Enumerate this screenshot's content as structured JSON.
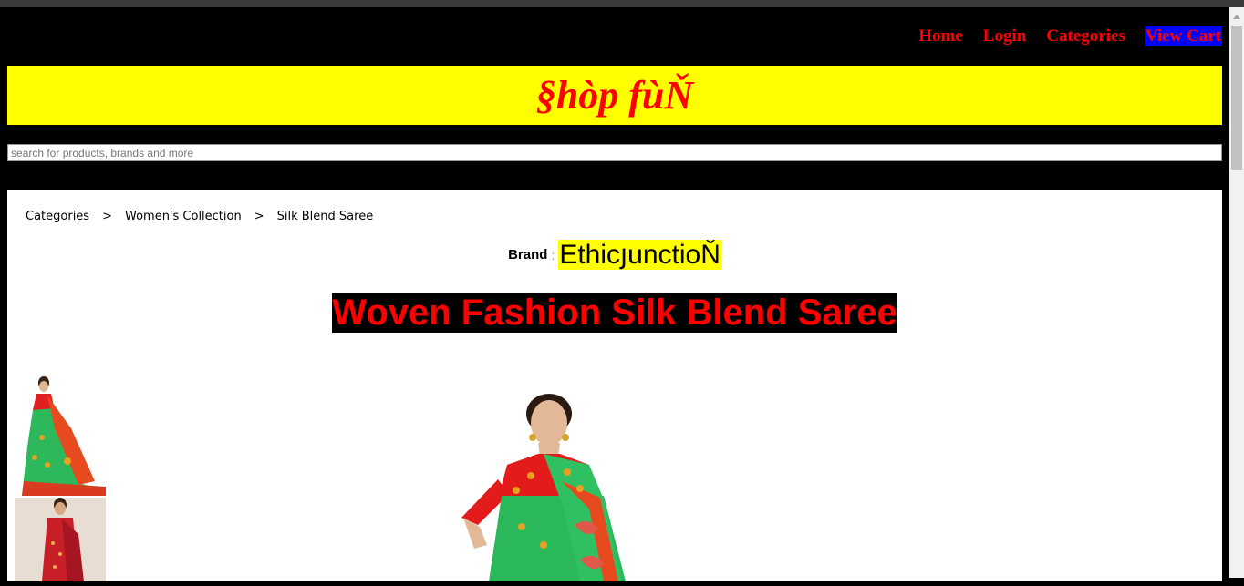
{
  "nav": {
    "items": [
      {
        "label": "Home"
      },
      {
        "label": "Login"
      },
      {
        "label": "Categories"
      },
      {
        "label": "View Cart"
      }
    ]
  },
  "banner": {
    "title": "§hòp fùŇ"
  },
  "search": {
    "placeholder": "search for products, brands and more"
  },
  "breadcrumb": {
    "items": [
      "Categories",
      "Women's Collection",
      "Silk Blend Saree"
    ],
    "separator": ">"
  },
  "product": {
    "brand_label": "Brand",
    "brand_colon": ":",
    "brand_name": "EthicյunctioŇ",
    "title": "Woven Fashion Silk Blend Saree"
  },
  "colors": {
    "accent_red": "#ff0000",
    "banner_yellow": "#ffff00",
    "active_nav_blue": "#0000ff",
    "saree_green": "#2eb85c"
  }
}
